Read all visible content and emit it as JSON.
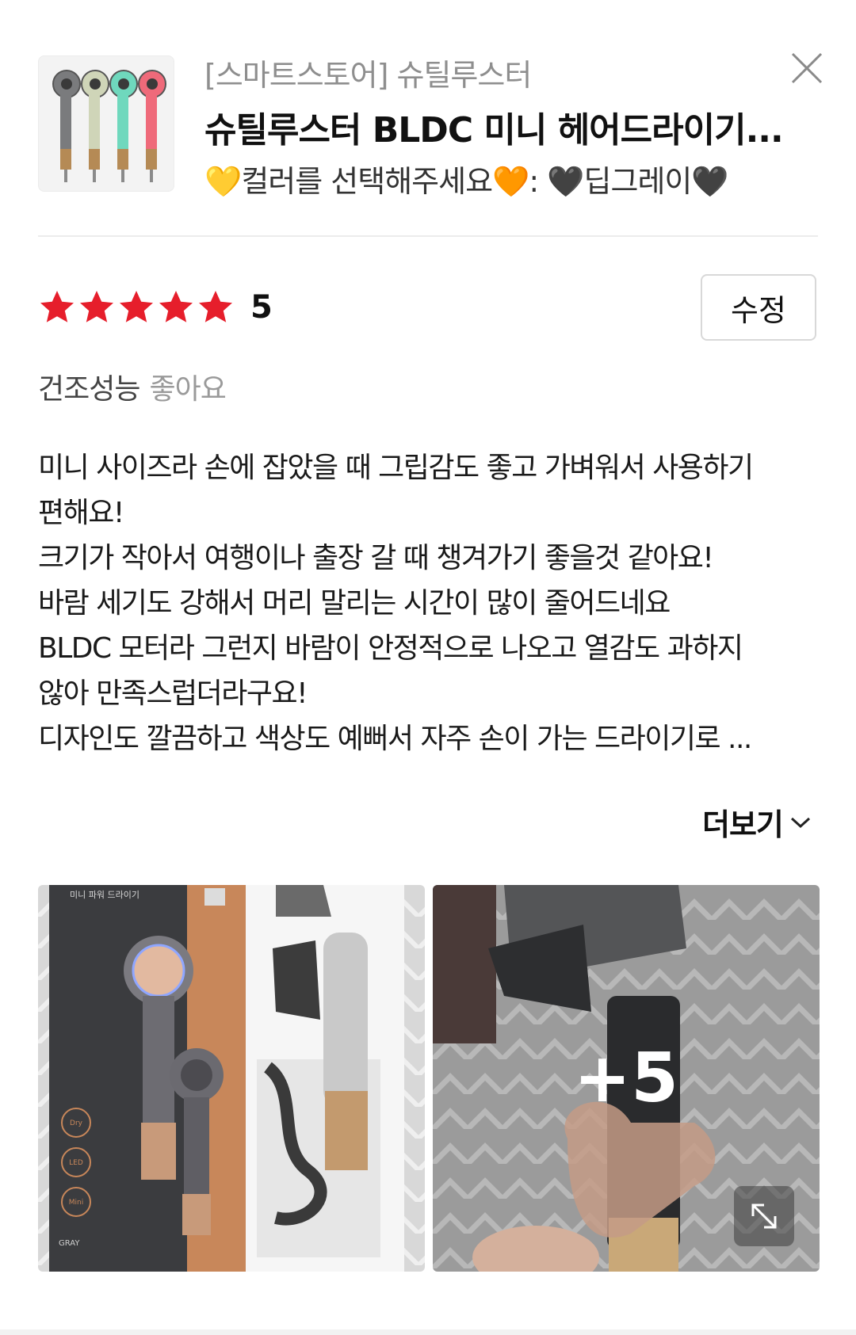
{
  "product": {
    "store": "[스마트스토어] 슈틸루스터",
    "title": "슈틸루스터 BLDC 미니 헤어드라이기...",
    "option": "💛컬러를 선택해주세요🧡: 🖤딥그레이🖤",
    "thumbnail_colors": [
      "#7a7b7d",
      "#cfd5b8",
      "#6fd8bd",
      "#ef6a7a"
    ]
  },
  "rating": {
    "score": 5,
    "score_text": "5",
    "star_color": "#e61e2b"
  },
  "actions": {
    "edit_label": "수정",
    "more_label": "더보기"
  },
  "attribute": {
    "key": "건조성능",
    "value": "좋아요"
  },
  "review": {
    "lines": [
      "미니 사이즈라 손에 잡았을 때 그립감도 좋고 가벼워서 사용하기",
      "편해요!",
      "크기가 작아서 여행이나 출장 갈 때 챙겨가기 좋을것 같아요!",
      "바람 세기도 강해서 머리 말리는 시간이 많이 줄어드네요",
      "BLDC 모터라 그런지 바람이 안정적으로 나오고 열감도 과하지",
      "않아 만족스럽더라구요!",
      "디자인도 깔끔하고 색상도 예뻐서 자주 손이 가는 드라이기로 ..."
    ]
  },
  "photos": {
    "box_heading": "미니 파워 드라이기",
    "box_modes": [
      "Dry",
      "LED",
      "Mini"
    ],
    "box_color": "GRAY",
    "extra_count": "+5"
  }
}
